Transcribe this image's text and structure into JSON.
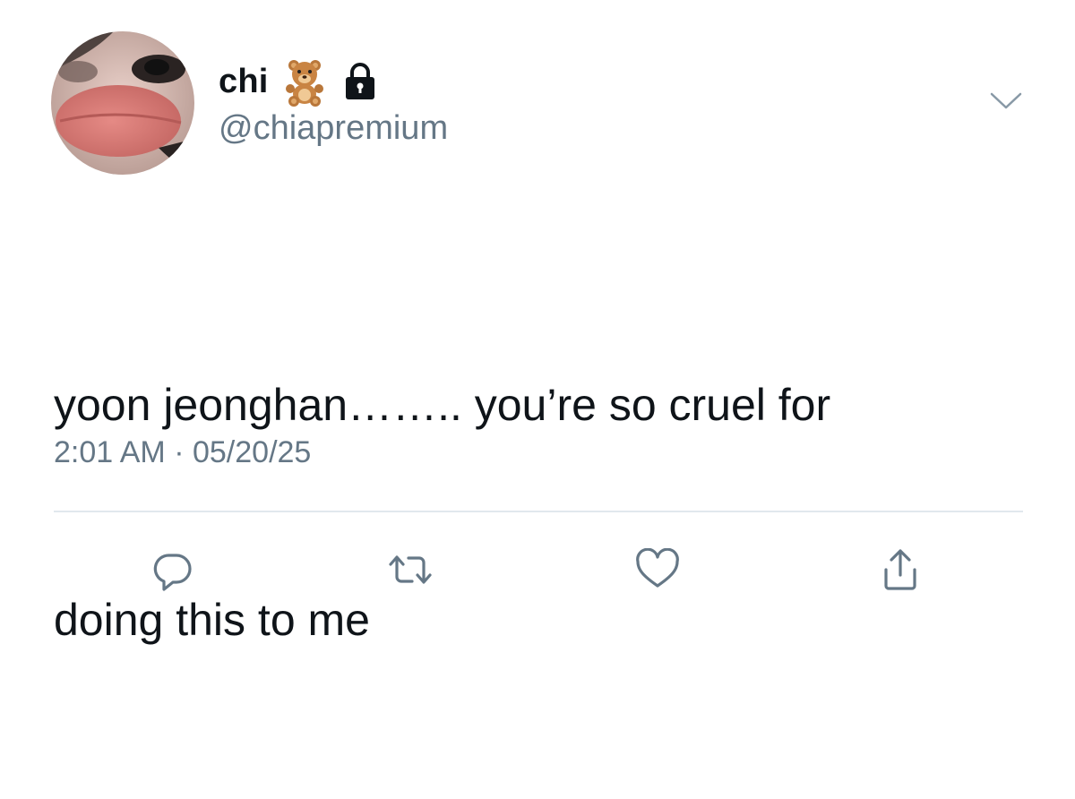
{
  "user": {
    "display_name": "chi",
    "handle": "@chiapremium",
    "name_emoji": "teddy-bear-emoji",
    "protected_badge": "lock-icon"
  },
  "tweet": {
    "text_lines": [
      "yoon jeonghan…….. you’re so cruel for",
      "doing this to me"
    ],
    "time": "2:01 AM",
    "separator": "·",
    "date": "05/20/25"
  },
  "actions": {
    "reply_icon": "reply-icon",
    "retweet_icon": "retweet-icon",
    "like_icon": "heart-icon",
    "share_icon": "share-icon"
  },
  "colors": {
    "text_primary": "#0f1419",
    "text_secondary": "#657786",
    "divider": "#e1e8ed",
    "icon": "#657786"
  }
}
